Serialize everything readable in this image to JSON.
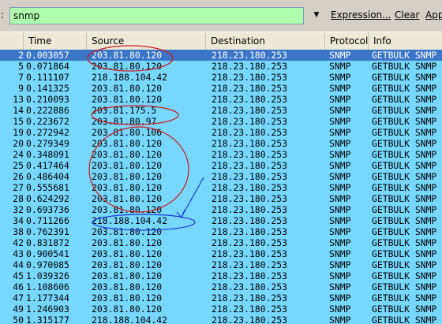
{
  "toolbar": {
    "filter_label": ":",
    "filter_value": "snmp",
    "dropdown_glyph": "▼",
    "expression_label": "Expression...",
    "clear_label": "Clear",
    "apply_label": "App",
    "filter_bg_color": "#afffaf"
  },
  "columns": {
    "no": "",
    "time": "Time",
    "source": "Source",
    "destination": "Destination",
    "protocol": "Protocol",
    "info": "Info"
  },
  "colors": {
    "row_bg": "#76d8ff",
    "selected_bg": "#3a76c7",
    "annotation_red": "#d01818",
    "annotation_blue": "#1a3ad6"
  },
  "rows": [
    {
      "no": "2",
      "time": "0.003057",
      "source": "203.81.80.120",
      "destination": "218.23.180.253",
      "protocol": "SNMP",
      "info": "GETBULK SNMP",
      "selected": true
    },
    {
      "no": "5",
      "time": "0.071864",
      "source": "203.81.80.120",
      "destination": "218.23.180.253",
      "protocol": "SNMP",
      "info": "GETBULK SNMP"
    },
    {
      "no": "7",
      "time": "0.111107",
      "source": "218.188.104.42",
      "destination": "218.23.180.253",
      "protocol": "SNMP",
      "info": "GETBULK SNMP"
    },
    {
      "no": "9",
      "time": "0.141325",
      "source": "203.81.80.120",
      "destination": "218.23.180.253",
      "protocol": "SNMP",
      "info": "GETBULK SNMP"
    },
    {
      "no": "13",
      "time": "0.210093",
      "source": "203.81.80.120",
      "destination": "218.23.180.253",
      "protocol": "SNMP",
      "info": "GETBULK SNMP"
    },
    {
      "no": "14",
      "time": "0.222886",
      "source": "203.81.175.5",
      "destination": "218.23.180.253",
      "protocol": "SNMP",
      "info": "GETBULK SNMP"
    },
    {
      "no": "15",
      "time": "0.223672",
      "source": "203.81.80.97",
      "destination": "218.23.180.253",
      "protocol": "SNMP",
      "info": "GETBULK SNMP"
    },
    {
      "no": "19",
      "time": "0.272942",
      "source": "203.81.80.106",
      "destination": "218.23.180.253",
      "protocol": "SNMP",
      "info": "GETBULK SNMP"
    },
    {
      "no": "20",
      "time": "0.279349",
      "source": "203.81.80.120",
      "destination": "218.23.180.253",
      "protocol": "SNMP",
      "info": "GETBULK SNMP"
    },
    {
      "no": "24",
      "time": "0.348091",
      "source": "203.81.80.120",
      "destination": "218.23.180.253",
      "protocol": "SNMP",
      "info": "GETBULK SNMP"
    },
    {
      "no": "25",
      "time": "0.417464",
      "source": "203.81.80.120",
      "destination": "218.23.180.253",
      "protocol": "SNMP",
      "info": "GETBULK SNMP"
    },
    {
      "no": "26",
      "time": "0.486404",
      "source": "203.81.80.120",
      "destination": "218.23.180.253",
      "protocol": "SNMP",
      "info": "GETBULK SNMP"
    },
    {
      "no": "27",
      "time": "0.555681",
      "source": "203.81.80.120",
      "destination": "218.23.180.253",
      "protocol": "SNMP",
      "info": "GETBULK SNMP"
    },
    {
      "no": "28",
      "time": "0.624292",
      "source": "203.81.80.120",
      "destination": "218.23.180.253",
      "protocol": "SNMP",
      "info": "GETBULK SNMP"
    },
    {
      "no": "32",
      "time": "0.693736",
      "source": "203.81.80.120",
      "destination": "218.23.180.253",
      "protocol": "SNMP",
      "info": "GETBULK SNMP"
    },
    {
      "no": "34",
      "time": "0.711266",
      "source": "218.188.104.42",
      "destination": "218.23.180.253",
      "protocol": "SNMP",
      "info": "GETBULK SNMP"
    },
    {
      "no": "38",
      "time": "0.762391",
      "source": "203.81.80.120",
      "destination": "218.23.180.253",
      "protocol": "SNMP",
      "info": "GETBULK SNMP"
    },
    {
      "no": "42",
      "time": "0.831872",
      "source": "203.81.80.120",
      "destination": "218.23.180.253",
      "protocol": "SNMP",
      "info": "GETBULK SNMP"
    },
    {
      "no": "43",
      "time": "0.900541",
      "source": "203.81.80.120",
      "destination": "218.23.180.253",
      "protocol": "SNMP",
      "info": "GETBULK SNMP"
    },
    {
      "no": "44",
      "time": "0.970085",
      "source": "203.81.80.120",
      "destination": "218.23.180.253",
      "protocol": "SNMP",
      "info": "GETBULK SNMP"
    },
    {
      "no": "45",
      "time": "1.039326",
      "source": "203.81.80.120",
      "destination": "218.23.180.253",
      "protocol": "SNMP",
      "info": "GETBULK SNMP"
    },
    {
      "no": "46",
      "time": "1.108606",
      "source": "203.81.80.120",
      "destination": "218.23.180.253",
      "protocol": "SNMP",
      "info": "GETBULK SNMP"
    },
    {
      "no": "47",
      "time": "1.177344",
      "source": "203.81.80.120",
      "destination": "218.23.180.253",
      "protocol": "SNMP",
      "info": "GETBULK SNMP"
    },
    {
      "no": "49",
      "time": "1.246903",
      "source": "203.81.80.120",
      "destination": "218.23.180.253",
      "protocol": "SNMP",
      "info": "GETBULK SNMP"
    },
    {
      "no": "50",
      "time": "1.315177",
      "source": "218.188.104.42",
      "destination": "218.23.180.253",
      "protocol": "SNMP",
      "info": "GETBULK SNMP"
    }
  ]
}
